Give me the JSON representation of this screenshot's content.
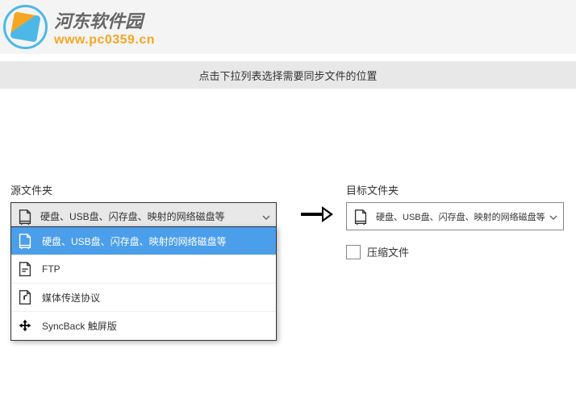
{
  "watermark": {
    "brand_cn": "河东软件园",
    "brand_url": "www.pc0359.cn"
  },
  "instruction": "点击下拉列表选择需要同步文件的位置",
  "source": {
    "label": "源文件夹",
    "selected": "硬盘、USB盘、闪存盘、映射的网络磁盘等"
  },
  "dropdown_options": [
    {
      "label": "硬盘、USB盘、闪存盘、映射的网络磁盘等",
      "icon": "drive",
      "selected": true
    },
    {
      "label": "FTP",
      "icon": "ftp",
      "selected": false
    },
    {
      "label": "媒体传送协议",
      "icon": "media",
      "selected": false
    },
    {
      "label": "SyncBack 触屏版",
      "icon": "syncback",
      "selected": false
    }
  ],
  "target": {
    "label": "目标文件夹",
    "selected": "硬盘、USB盘、闪存盘、映射的网络磁盘等"
  },
  "compress": {
    "label": "压缩文件",
    "checked": false
  }
}
